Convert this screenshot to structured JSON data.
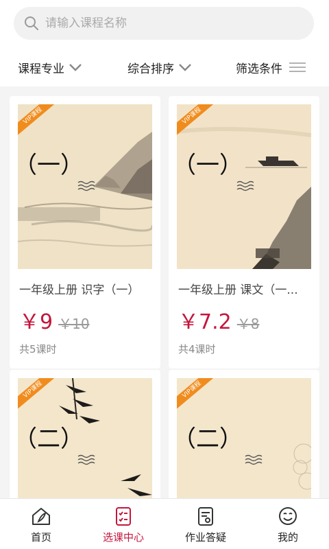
{
  "search": {
    "placeholder": "请输入课程名称"
  },
  "filters": {
    "major": "课程专业",
    "sort": "综合排序",
    "conditions": "筛选条件"
  },
  "courses": [
    {
      "vip": "VIP课程",
      "cover_text": "（一）",
      "title": "一年级上册 识字（一）",
      "price": "￥9",
      "original_price": "￥10",
      "lessons": "共5课时"
    },
    {
      "vip": "VIP课程",
      "cover_text": "（一）",
      "title": "一年级上册 课文（一...",
      "price": "￥7.2",
      "original_price": "￥8",
      "lessons": "共4课时"
    },
    {
      "vip": "VIP课程",
      "cover_text": "（二）"
    },
    {
      "vip": "VIP课程",
      "cover_text": "（二）"
    }
  ],
  "nav": {
    "home": "首页",
    "courses": "选课中心",
    "homework": "作业答疑",
    "mine": "我的",
    "active_color": "#c4163c"
  }
}
